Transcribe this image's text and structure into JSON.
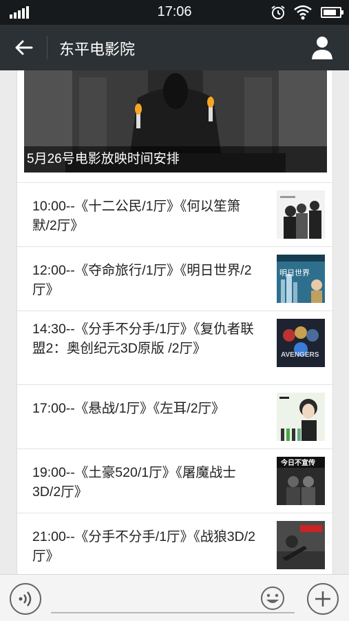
{
  "status_bar": {
    "time": "17:06",
    "icons": [
      "signal-icon",
      "alarm-icon",
      "wifi-icon",
      "battery-icon"
    ]
  },
  "nav": {
    "title": "东平电影院",
    "back_icon": "arrow-left-icon",
    "profile_icon": "user-icon"
  },
  "banner": {
    "caption": "5月26号电影放映时间安排"
  },
  "schedule": [
    {
      "text": "10:00--《十二公民/1厅》《何以笙箫默/2厅》"
    },
    {
      "text": "12:00--《夺命旅行/1厅》《明日世界/2厅》"
    },
    {
      "text": "14:30--《分手不分手/1厅》《复仇者联盟2：奥创纪元3D原版 /2厅》"
    },
    {
      "text": "17:00--《悬战/1厅》《左耳/2厅》"
    },
    {
      "text": "19:00--《土豪520/1厅》《屠魔战士3D/2厅》"
    },
    {
      "text": "21:00--《分手不分手/1厅》《战狼3D/2厅》"
    }
  ],
  "poster_texts": {
    "p2": "明日世界",
    "p3": "AVENGERS",
    "p5": "今日不宣传"
  },
  "input_bar": {
    "placeholder": "",
    "icons": [
      "voice-icon",
      "emoji-icon",
      "plus-icon"
    ]
  }
}
